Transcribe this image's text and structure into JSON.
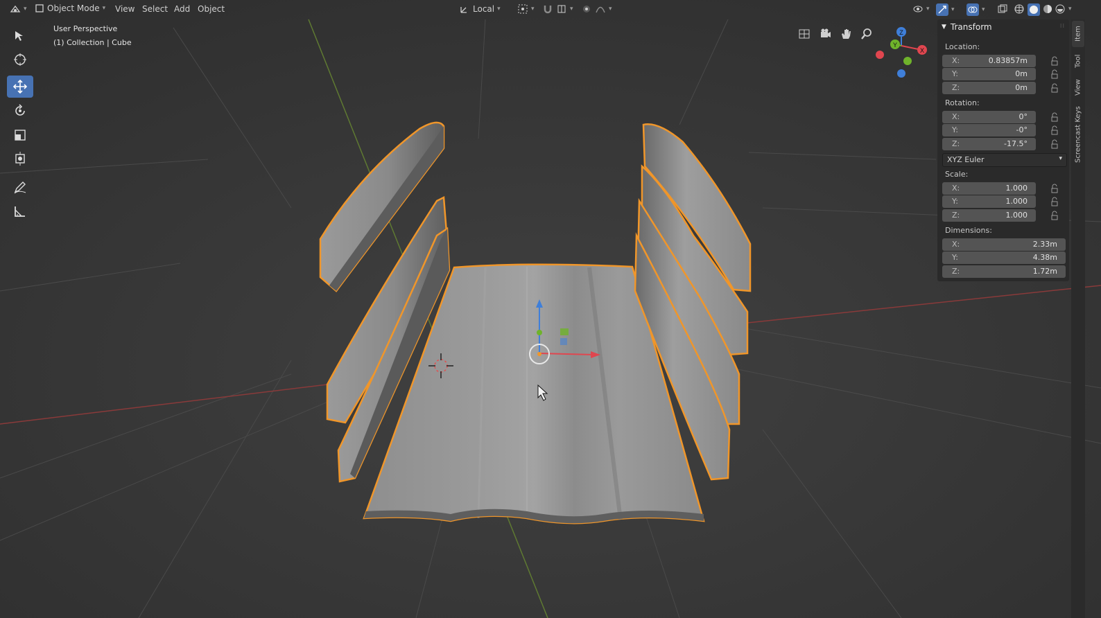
{
  "header": {
    "mode_label": "Object Mode",
    "menus": [
      "View",
      "Select",
      "Add",
      "Object"
    ],
    "transform_orientation": "Local"
  },
  "viewport": {
    "perspective_label": "User Perspective",
    "collection_label": "(1) Collection | Cube"
  },
  "panel": {
    "title": "Transform",
    "location_label": "Location:",
    "location": [
      {
        "axis": "X:",
        "value": "0.83857m"
      },
      {
        "axis": "Y:",
        "value": "0m"
      },
      {
        "axis": "Z:",
        "value": "0m"
      }
    ],
    "rotation_label": "Rotation:",
    "rotation": [
      {
        "axis": "X:",
        "value": "0°"
      },
      {
        "axis": "Y:",
        "value": "-0°"
      },
      {
        "axis": "Z:",
        "value": "-17.5°"
      }
    ],
    "rotation_mode": "XYZ Euler",
    "scale_label": "Scale:",
    "scale": [
      {
        "axis": "X:",
        "value": "1.000"
      },
      {
        "axis": "Y:",
        "value": "1.000"
      },
      {
        "axis": "Z:",
        "value": "1.000"
      }
    ],
    "dimensions_label": "Dimensions:",
    "dimensions": [
      {
        "axis": "X:",
        "value": "2.33m"
      },
      {
        "axis": "Y:",
        "value": "4.38m"
      },
      {
        "axis": "Z:",
        "value": "1.72m"
      }
    ]
  },
  "sidebar_tabs": [
    "Item",
    "Tool",
    "View",
    "Screencast Keys"
  ],
  "gizmo": {
    "x": "X",
    "y": "Y",
    "z": "Z"
  },
  "colors": {
    "selection_outline": "#f0962a",
    "active_tool": "#4772b3",
    "axis_x": "#e0464f",
    "axis_y": "#6fb32b",
    "axis_z": "#3f7fd9"
  }
}
